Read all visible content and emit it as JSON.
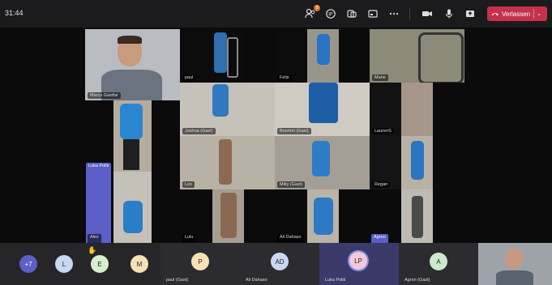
{
  "topbar": {
    "clock": "31:44",
    "participants_badge": "9",
    "leave_label": "Verlassen",
    "icons": [
      "participants-icon",
      "chat-icon",
      "reactions-icon",
      "share-icon",
      "more-icon",
      "camera-icon",
      "mic-icon",
      "share-screen-icon"
    ]
  },
  "tiles": {
    "marco": "Marco Gastfar",
    "paul": "paul",
    "felix": "Felix",
    "marie": "Marie",
    "joshua": "Joshua (Gast)",
    "baumann": "Boomm (Gast)",
    "lauren": "LaurenS",
    "luka": "Luka Polik",
    "leo": "Leo",
    "miky": "Miky (Gast)",
    "regan": "Regan",
    "alex": "Alex",
    "lulu": "Lulu",
    "ali": "Ali Dahaso",
    "agron": "Agron"
  },
  "bottom": {
    "overflow": "+7",
    "avatars": [
      {
        "initial": "L",
        "color": "#c7d8f3"
      },
      {
        "initial": "E",
        "color": "#d7efcf"
      },
      {
        "initial": "M",
        "color": "#f6e0b6"
      }
    ],
    "participants": [
      {
        "initial": "P",
        "label": "paul (Gast)",
        "color": "#f6e2b3"
      },
      {
        "initial": "AD",
        "label": "Ali Dahaso",
        "color": "#c9d8f2"
      },
      {
        "initial": "LP",
        "label": "Luka Polik",
        "color": "#f4c9d6"
      },
      {
        "initial": "A",
        "label": "Agron (Gast)",
        "color": "#cfe9cf"
      }
    ]
  }
}
